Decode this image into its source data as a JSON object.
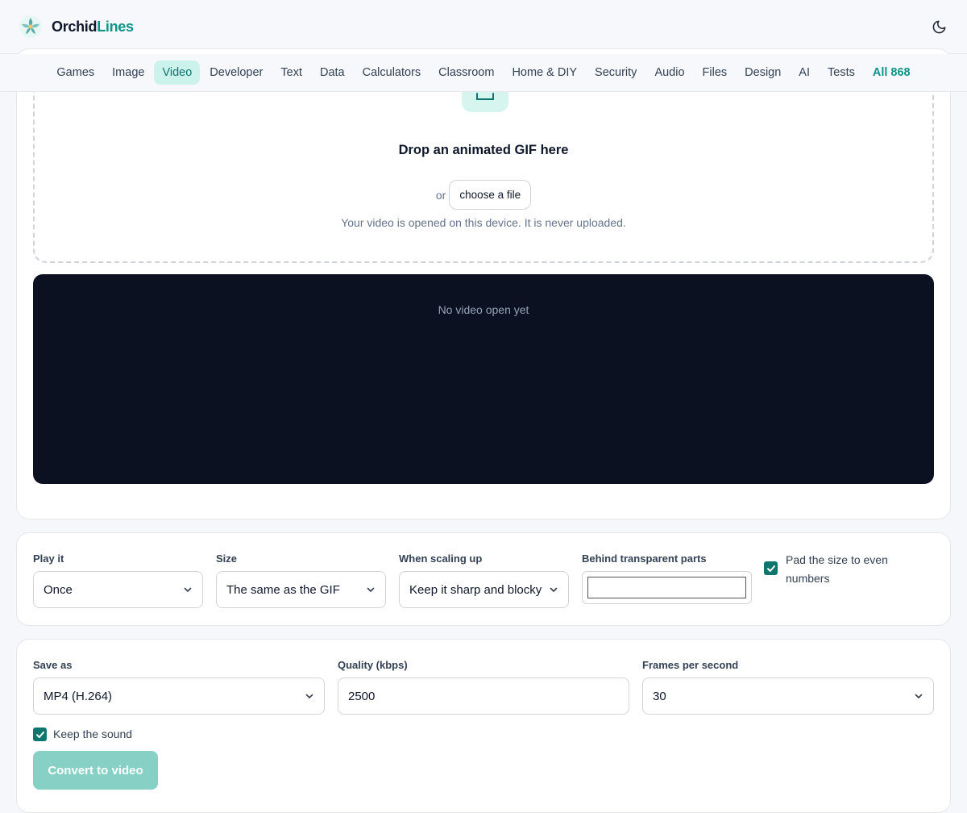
{
  "brand": {
    "name_part1": "Orchid",
    "name_part2": "Lines"
  },
  "icons": {
    "logo": "orchid-logo-icon",
    "theme": "moon-icon",
    "chevron": "chevron-down-icon",
    "check": "check-icon",
    "upload": "upload-icon"
  },
  "colors": {
    "accent": "#0d9488",
    "active_tab_bg": "#ccf2ec",
    "player_bg": "#0b1120",
    "button_disabled": "#86d0c6"
  },
  "nav": {
    "items": [
      {
        "label": "Games"
      },
      {
        "label": "Image"
      },
      {
        "label": "Video",
        "active": true
      },
      {
        "label": "Developer"
      },
      {
        "label": "Text"
      },
      {
        "label": "Data"
      },
      {
        "label": "Calculators"
      },
      {
        "label": "Classroom"
      },
      {
        "label": "Home & DIY"
      },
      {
        "label": "Security"
      },
      {
        "label": "Audio"
      },
      {
        "label": "Files"
      },
      {
        "label": "Design"
      },
      {
        "label": "AI"
      },
      {
        "label": "Tests"
      },
      {
        "label": "All 868"
      }
    ]
  },
  "dropzone": {
    "title": "Drop an animated GIF here",
    "or": "or",
    "choose_label": "choose a file",
    "note": "Your video is opened on this device. It is never uploaded."
  },
  "player": {
    "empty_message": "No video open yet"
  },
  "options": {
    "play_label": "Play it",
    "play_value": "Once",
    "size_label": "Size",
    "size_value": "The same as the GIF",
    "scaling_label": "When scaling up",
    "scaling_value": "Keep it sharp and blocky",
    "transparent_label": "Behind transparent parts",
    "pad_label": "Pad the size to even numbers",
    "pad_checked": true
  },
  "save": {
    "format_label": "Save as",
    "format_value": "MP4 (H.264)",
    "quality_label": "Quality (kbps)",
    "quality_value": "2500",
    "fps_label": "Frames per second",
    "fps_value": "30",
    "sound_label": "Keep the sound",
    "sound_checked": true,
    "convert_label": "Convert to video"
  }
}
